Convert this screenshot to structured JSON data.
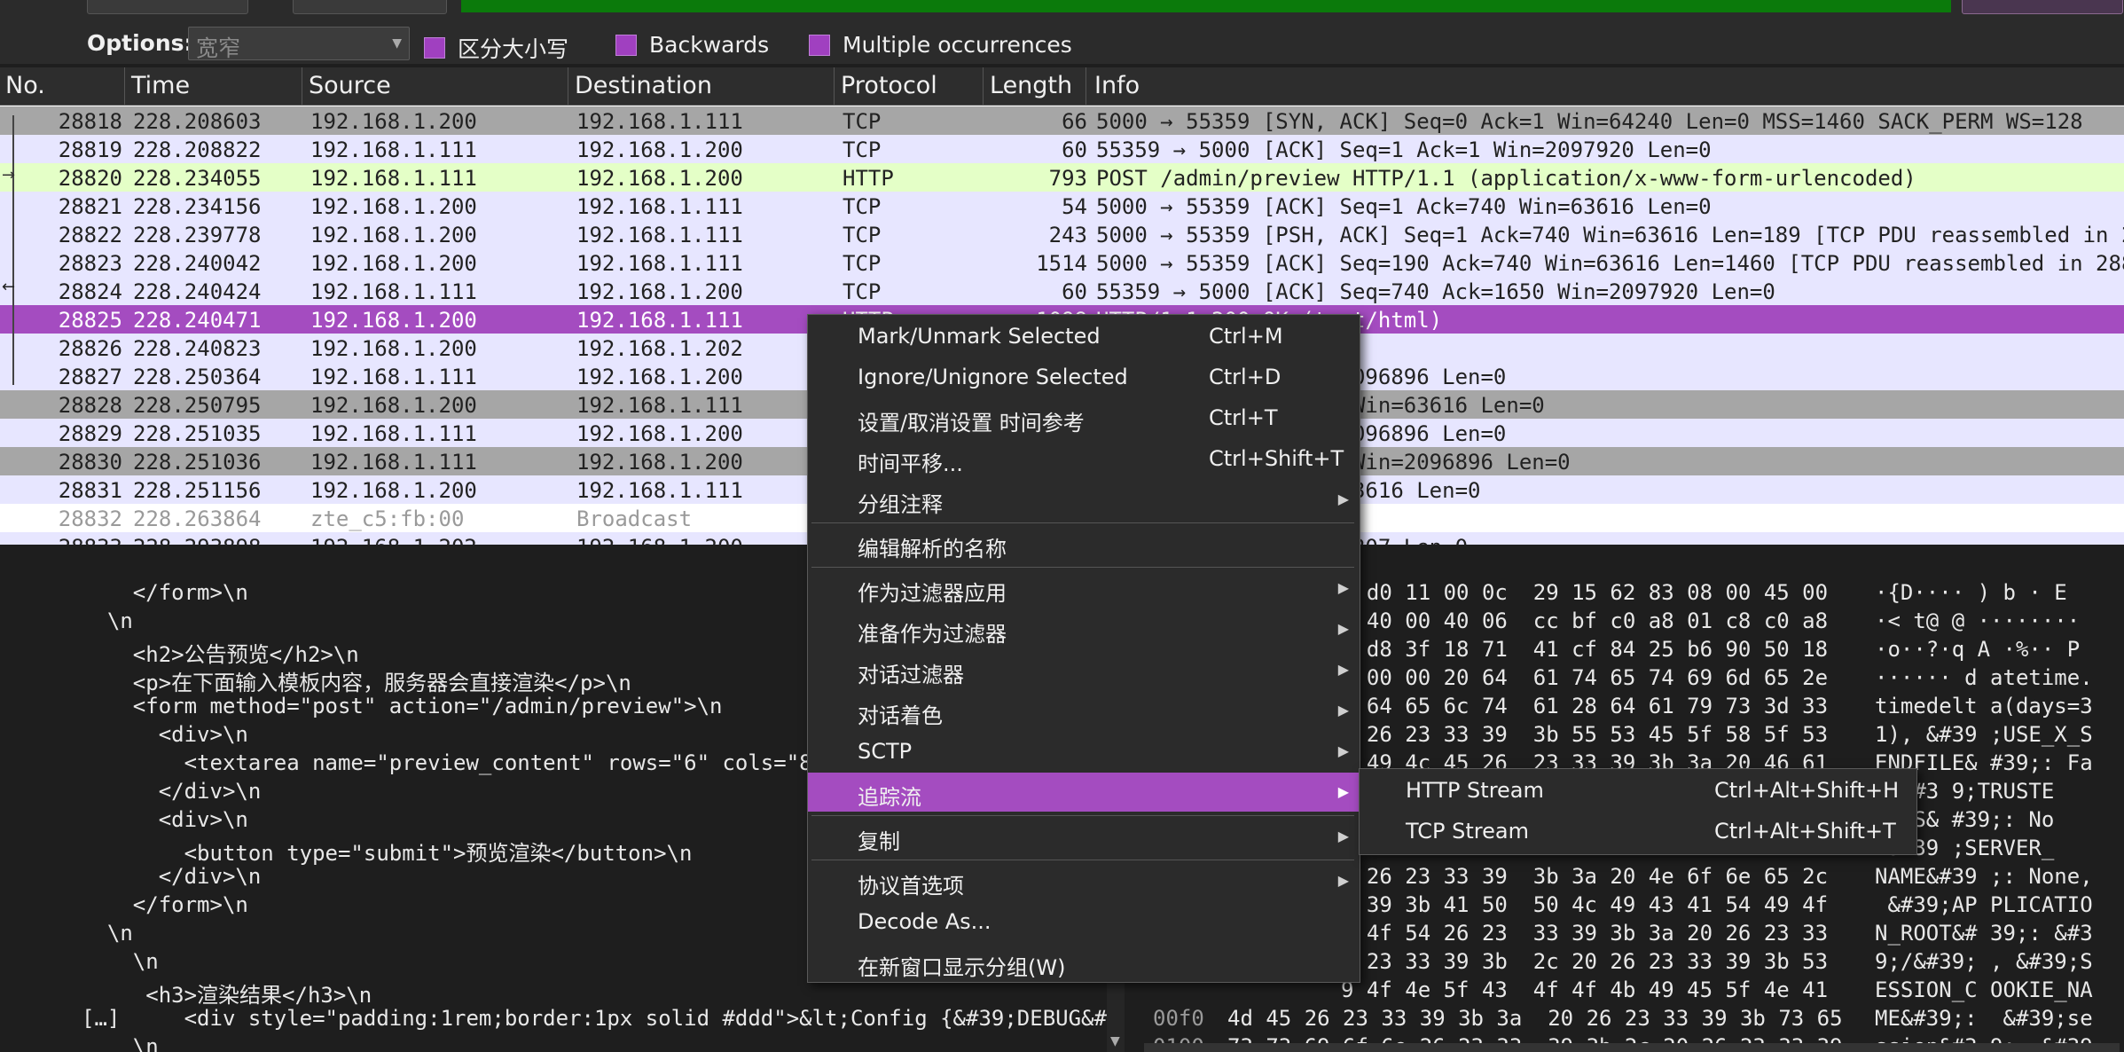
{
  "toolbar": {
    "options_label": "Options:",
    "charset_value": "宽窄",
    "case_sensitive_label": "区分大小写",
    "backwards_label": "Backwards",
    "multiple_label": "Multiple occurrences"
  },
  "columns": [
    "No.",
    "Time",
    "Source",
    "Destination",
    "Protocol",
    "Length",
    "Info"
  ],
  "packets": [
    {
      "no": "28818",
      "time": "228.208603",
      "src": "192.168.1.200",
      "dst": "192.168.1.111",
      "proto": "TCP",
      "len": "66",
      "info": "5000 → 55359 [SYN, ACK] Seq=0 Ack=1 Win=64240 Len=0 MSS=1460 SACK_PERM WS=128",
      "bg": "#a6a6a6"
    },
    {
      "no": "28819",
      "time": "228.208822",
      "src": "192.168.1.111",
      "dst": "192.168.1.200",
      "proto": "TCP",
      "len": "60",
      "info": "55359 → 5000 [ACK] Seq=1 Ack=1 Win=2097920 Len=0",
      "bg": "#e7e6ff"
    },
    {
      "no": "28820",
      "time": "228.234055",
      "src": "192.168.1.111",
      "dst": "192.168.1.200",
      "proto": "HTTP",
      "len": "793",
      "info": "POST /admin/preview HTTP/1.1  (application/x-www-form-urlencoded)",
      "bg": "#e4ffc7"
    },
    {
      "no": "28821",
      "time": "228.234156",
      "src": "192.168.1.200",
      "dst": "192.168.1.111",
      "proto": "TCP",
      "len": "54",
      "info": "5000 → 55359 [ACK] Seq=1 Ack=740 Win=63616 Len=0",
      "bg": "#e7e6ff"
    },
    {
      "no": "28822",
      "time": "228.239778",
      "src": "192.168.1.200",
      "dst": "192.168.1.111",
      "proto": "TCP",
      "len": "243",
      "info": "5000 → 55359 [PSH, ACK] Seq=1 Ack=740 Win=63616 Len=189 [TCP PDU reassembled in 28",
      "bg": "#e7e6ff"
    },
    {
      "no": "28823",
      "time": "228.240042",
      "src": "192.168.1.200",
      "dst": "192.168.1.111",
      "proto": "TCP",
      "len": "1514",
      "info": "5000 → 55359 [ACK] Seq=190 Ack=740 Win=63616 Len=1460 [TCP PDU reassembled in 288",
      "bg": "#e7e6ff"
    },
    {
      "no": "28824",
      "time": "228.240424",
      "src": "192.168.1.111",
      "dst": "192.168.1.200",
      "proto": "TCP",
      "len": "60",
      "info": "55359 → 5000 [ACK] Seq=740 Ack=1650 Win=2097920 Len=0",
      "bg": "#e7e6ff"
    },
    {
      "no": "28825",
      "time": "228.240471",
      "src": "192.168.1.200",
      "dst": "192.168.1.111",
      "proto": "HTTP",
      "len": "1098",
      "info": "HTTP/1.1 200 OK  (text/html)",
      "bg": "#a44cc0",
      "selected": true
    },
    {
      "no": "28826",
      "time": "228.240823",
      "src": "192.168.1.200",
      "dst": "192.168.1.202",
      "proto": "",
      "len": "",
      "info": "ket (len=116)",
      "bg": "#e7e6ff"
    },
    {
      "no": "28827",
      "time": "228.250364",
      "src": "192.168.1.111",
      "dst": "192.168.1.200",
      "proto": "",
      "len": "",
      "info": "q=740 Ack=2694 Win=2096896 Len=0",
      "bg": "#e7e6ff"
    },
    {
      "no": "28828",
      "time": "228.250795",
      "src": "192.168.1.200",
      "dst": "192.168.1.111",
      "proto": "",
      "len": "",
      "info": "K] Seq=2694 Ack=740 Win=63616 Len=0",
      "bg": "#a6a6a6"
    },
    {
      "no": "28829",
      "time": "228.251035",
      "src": "192.168.1.111",
      "dst": "192.168.1.200",
      "proto": "",
      "len": "",
      "info": "q=740 Ack=2695 Win=2096896 Len=0",
      "bg": "#e7e6ff"
    },
    {
      "no": "28830",
      "time": "228.251036",
      "src": "192.168.1.111",
      "dst": "192.168.1.200",
      "proto": "",
      "len": "",
      "info": "K] Seq=740 Ack=2695 Win=2096896 Len=0",
      "bg": "#a6a6a6"
    },
    {
      "no": "28831",
      "time": "228.251156",
      "src": "192.168.1.200",
      "dst": "192.168.1.111",
      "proto": "",
      "len": "",
      "info": "q=2695 Ack=741 Win=63616 Len=0",
      "bg": "#e7e6ff"
    },
    {
      "no": "28832",
      "time": "228.263864",
      "src": "zte_c5:fb:00",
      "dst": "Broadcast",
      "proto": "",
      "len": "",
      "info": "",
      "bg": "#ffffff",
      "dim": true
    },
    {
      "no": "28833",
      "time": "228.293898",
      "src": "192.168.1.202",
      "dst": "192.168.1.200",
      "proto": "",
      "len": "",
      "info": "109 Ack=211853 Win=8207 Len=0",
      "bg": "#e7e6ff"
    }
  ],
  "detail_lines": [
    "    </form>\\n",
    "  \\n",
    "    <h2>公告预览</h2>\\n",
    "    <p>在下面输入模板内容，服务器会直接渲染</p>\\n",
    "    <form method=\"post\" action=\"/admin/preview\">\\n",
    "      <div>\\n",
    "        <textarea name=\"preview_content\" rows=\"6\" cols=\"80\">",
    "      </div>\\n",
    "      <div>\\n",
    "        <button type=\"submit\">预览渲染</button>\\n",
    "      </div>\\n",
    "    </form>\\n",
    "  \\n",
    "    \\n",
    "     <h3>渲染结果</h3>\\n",
    "[…]     <div style=\"padding:1rem;border:1px solid #ddd\">&lt;Config {&#39;DEBUG&#3",
    "    \\n"
  ],
  "hex_lines": [
    {
      "off": "",
      "bytes": "0 d0 11 00 0c  29 15 62 83 08 00 45 00",
      "ascii": "·{D···· ) b · E"
    },
    {
      "off": "",
      "bytes": "4 40 00 40 06  cc bf c0 a8 01 c8 c0 a8",
      "ascii": "·< t@ @ ········"
    },
    {
      "off": "",
      "bytes": "8 d8 3f 18 71  41 cf 84 25 b6 90 50 18",
      "ascii": "·o··?·q A ·%·· P"
    },
    {
      "off": "",
      "bytes": "5 00 00 20 64  61 74 65 74 69 6d 65 2e",
      "ascii": "······ d atetime."
    },
    {
      "off": "",
      "bytes": "5 64 65 6c 74  61 28 64 61 79 73 3d 33",
      "ascii": "timedelt a(days=3"
    },
    {
      "off": "",
      "bytes": "0 26 23 33 39  3b 55 53 45 5f 58 5f 53",
      "ascii": "1), &#39 ;USE_X_S"
    },
    {
      "off": "",
      "bytes": "5 49 4c 45 26  23 33 39 3b 3a 20 46 61",
      "ascii": "ENDFILE& #39;: Fa"
    },
    {
      "off": "",
      "bytes": "",
      "ascii": ", &#3 9;TRUSTE"
    },
    {
      "off": "",
      "bytes": "",
      "ascii": "OSTS& #39;: No"
    },
    {
      "off": "",
      "bytes": "",
      "ascii": " &#39 ;SERVER_"
    },
    {
      "off": "",
      "bytes": "5 26 23 33 39  3b 3a 20 4e 6f 6e 65 2c",
      "ascii": "NAME&#39 ;: None,"
    },
    {
      "off": "",
      "bytes": "3 39 3b 41 50  50 4c 49 43 41 54 49 4f",
      "ascii": " &#39;AP PLICATIO"
    },
    {
      "off": "",
      "bytes": "f 4f 54 26 23  33 39 3b 3a 20 26 23 33",
      "ascii": "N_ROOT&# 39;: &#3"
    },
    {
      "off": "",
      "bytes": "5 23 33 39 3b  2c 20 26 23 33 39 3b 53",
      "ascii": "9;/&#39; , &#39;S"
    },
    {
      "off": "",
      "bytes": "9 4f 4e 5f 43  4f 4f 4b 49 45 5f 4e 41",
      "ascii": "ESSION_C OOKIE_NA"
    },
    {
      "off": "00f0",
      "bytes": "4d 45 26 23 33 39 3b 3a  20 26 23 33 39 3b 73 65",
      "ascii": "ME&#39;:  &#39;se"
    },
    {
      "off": "0100",
      "bytes": "73 73 69 6f 6e 26 23 33  39 3b 2c 20 26 23 33 39",
      "ascii": "ssion&#3 9;, &#39"
    }
  ],
  "context_menu": {
    "mark": {
      "label": "Mark/Unmark Selected",
      "shortcut": "Ctrl+M"
    },
    "ignore": {
      "label": "Ignore/Unignore Selected",
      "shortcut": "Ctrl+D"
    },
    "time_ref": {
      "label": "设置/取消设置 时间参考",
      "shortcut": "Ctrl+T"
    },
    "time_shift": {
      "label": "时间平移...",
      "shortcut": "Ctrl+Shift+T"
    },
    "comment": {
      "label": "分组注释"
    },
    "edit_name": {
      "label": "编辑解析的名称"
    },
    "apply_filter": {
      "label": "作为过滤器应用"
    },
    "prepare_filter": {
      "label": "准备作为过滤器"
    },
    "conv_filter": {
      "label": "对话过滤器"
    },
    "colorize": {
      "label": "对话着色"
    },
    "sctp": {
      "label": "SCTP"
    },
    "follow": {
      "label": "追踪流"
    },
    "copy": {
      "label": "复制"
    },
    "proto_prefs": {
      "label": "协议首选项"
    },
    "decode_as": {
      "label": "Decode As..."
    },
    "new_window": {
      "label": "在新窗口显示分组(W)"
    }
  },
  "submenu": {
    "http": {
      "label": "HTTP Stream",
      "shortcut": "Ctrl+Alt+Shift+H"
    },
    "tcp": {
      "label": "TCP Stream",
      "shortcut": "Ctrl+Alt+Shift+T"
    }
  },
  "colors": {
    "accent": "#a44cc0",
    "tcp_row": "#e7e6ff",
    "http_row": "#e4ffc7",
    "gray_row": "#a6a6a6",
    "find_field": "#0b7a0b"
  }
}
